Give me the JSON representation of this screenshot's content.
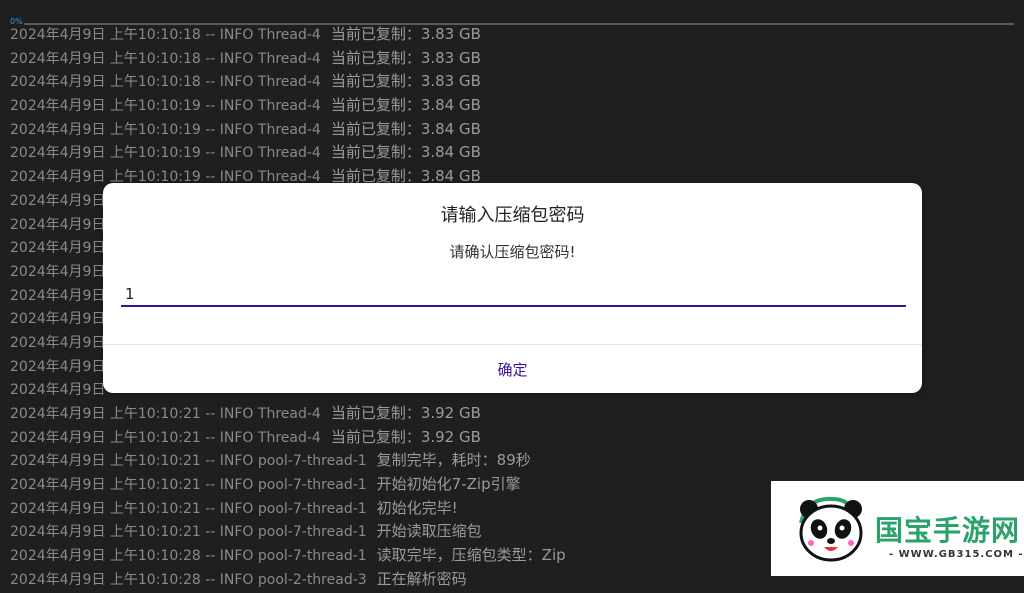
{
  "progress": {
    "label": "0%",
    "value_percent": 0
  },
  "log_lines": [
    {
      "prefix": "2024年4月9日 上午10:10:18 -- INFO Thread-4",
      "msg": "当前已复制：3.83 GB"
    },
    {
      "prefix": "2024年4月9日 上午10:10:18 -- INFO Thread-4",
      "msg": "当前已复制：3.83 GB"
    },
    {
      "prefix": "2024年4月9日 上午10:10:18 -- INFO Thread-4",
      "msg": "当前已复制：3.83 GB"
    },
    {
      "prefix": "2024年4月9日 上午10:10:19 -- INFO Thread-4",
      "msg": "当前已复制：3.84 GB"
    },
    {
      "prefix": "2024年4月9日 上午10:10:19 -- INFO Thread-4",
      "msg": "当前已复制：3.84 GB"
    },
    {
      "prefix": "2024年4月9日 上午10:10:19 -- INFO Thread-4",
      "msg": "当前已复制：3.84 GB"
    },
    {
      "prefix": "2024年4月9日 上午10:10:19 -- INFO Thread-4",
      "msg": "当前已复制：3.84 GB"
    },
    {
      "prefix": "2024年4月9日",
      "msg": ""
    },
    {
      "prefix": "2024年4月9日",
      "msg": ""
    },
    {
      "prefix": "2024年4月9日",
      "msg": ""
    },
    {
      "prefix": "2024年4月9日",
      "msg": ""
    },
    {
      "prefix": "2024年4月9日",
      "msg": ""
    },
    {
      "prefix": "2024年4月9日",
      "msg": ""
    },
    {
      "prefix": "2024年4月9日",
      "msg": ""
    },
    {
      "prefix": "2024年4月9日",
      "msg": ""
    },
    {
      "prefix": "2024年4月9日",
      "msg": ""
    },
    {
      "prefix": "2024年4月9日 上午10:10:21 -- INFO Thread-4",
      "msg": "当前已复制：3.92 GB"
    },
    {
      "prefix": "2024年4月9日 上午10:10:21 -- INFO Thread-4",
      "msg": "当前已复制：3.92 GB"
    },
    {
      "prefix": "2024年4月9日 上午10:10:21 -- INFO pool-7-thread-1",
      "msg": "复制完毕，耗时：89秒"
    },
    {
      "prefix": "2024年4月9日 上午10:10:21 -- INFO pool-7-thread-1",
      "msg": "开始初始化7-Zip引擎"
    },
    {
      "prefix": "2024年4月9日 上午10:10:21 -- INFO pool-7-thread-1",
      "msg": "初始化完毕!"
    },
    {
      "prefix": "2024年4月9日 上午10:10:21 -- INFO pool-7-thread-1",
      "msg": "开始读取压缩包"
    },
    {
      "prefix": "2024年4月9日 上午10:10:28 -- INFO pool-7-thread-1",
      "msg": "读取完毕，压缩包类型：Zip"
    },
    {
      "prefix": "2024年4月9日 上午10:10:28 -- INFO pool-2-thread-3",
      "msg": "正在解析密码"
    }
  ],
  "dialog": {
    "title": "请输入压缩包密码",
    "message": "请确认压缩包密码!",
    "input_value": "1",
    "ok_label": "确定",
    "accent_color": "#3b1496"
  },
  "watermark": {
    "brand": "国宝手游网",
    "url": "- WWW.GB315.COM -",
    "icon": "panda-logo-icon"
  }
}
